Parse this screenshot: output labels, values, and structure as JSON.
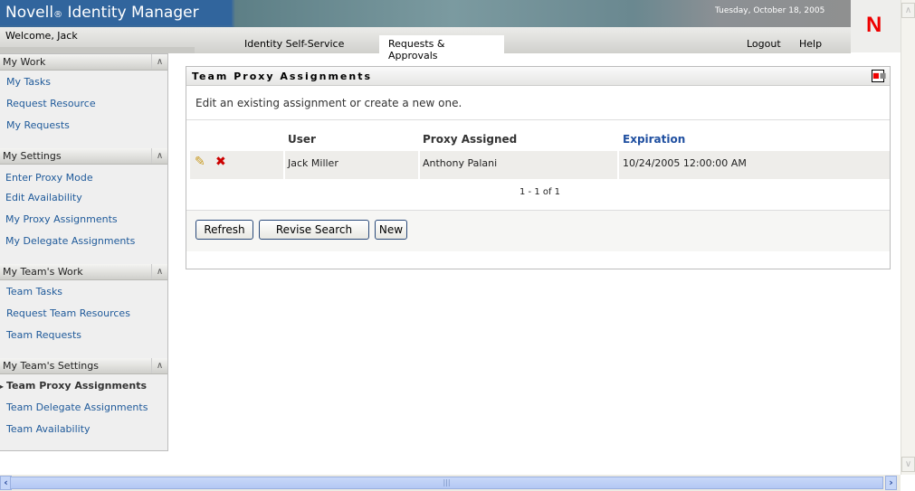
{
  "header": {
    "brand": "Novell",
    "reg": "®",
    "product": "Identity Manager",
    "date": "Tuesday, October 18, 2005",
    "welcome": "Welcome, Jack",
    "logo": "N"
  },
  "tabs": [
    {
      "label": "Identity Self-Service"
    },
    {
      "label": "Requests & Approvals"
    }
  ],
  "links": {
    "logout": "Logout",
    "help": "Help"
  },
  "sidebar": {
    "sections": [
      {
        "title": "My Work",
        "items": [
          "My Tasks",
          "Request Resource",
          "My Requests"
        ]
      },
      {
        "title": "My Settings",
        "items": [
          "Enter Proxy Mode",
          "Edit Availability",
          "My Proxy Assignments",
          "My Delegate Assignments"
        ]
      },
      {
        "title": "My Team's Work",
        "items": [
          "Team Tasks",
          "Request Team Resources",
          "Team Requests"
        ]
      },
      {
        "title": "My Team's Settings",
        "items": [
          "Team Proxy Assignments",
          "Team Delegate Assignments",
          "Team Availability"
        ]
      }
    ]
  },
  "panel": {
    "title": "Team Proxy Assignments",
    "description": "Edit an existing assignment or create a new one.",
    "columns": [
      "User",
      "Proxy Assigned",
      "Expiration"
    ],
    "rows": [
      {
        "user": "Jack Miller",
        "proxy": "Anthony Palani",
        "expiration": "10/24/2005 12:00:00 AM"
      }
    ],
    "pager": "1 - 1 of 1",
    "buttons": {
      "refresh": "Refresh",
      "revise": "Revise Search",
      "new": "New"
    }
  },
  "colors": {
    "accent": "#31659d",
    "link": "#1f5a9a",
    "sort_header": "#1f4fa0",
    "logo": "#e00000"
  }
}
